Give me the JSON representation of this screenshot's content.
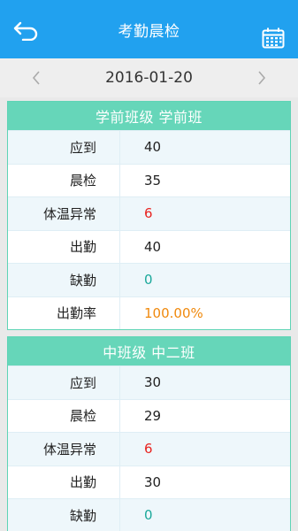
{
  "header": {
    "title": "考勤晨检",
    "back_icon": "back-icon",
    "calendar_icon": "calendar-icon",
    "accent_color": "#21a1ef"
  },
  "date_nav": {
    "date": "2016-01-20",
    "prev_icon": "chevron-left-icon",
    "next_icon": "chevron-right-icon"
  },
  "classes": [
    {
      "title": "学前班级 学前班",
      "rows": [
        {
          "label": "应到",
          "value": "40"
        },
        {
          "label": "晨检",
          "value": "35"
        },
        {
          "label": "体温异常",
          "value": "6"
        },
        {
          "label": "出勤",
          "value": "40"
        },
        {
          "label": "缺勤",
          "value": "0"
        },
        {
          "label": "出勤率",
          "value": "100.00%"
        }
      ]
    },
    {
      "title": "中班级 中二班",
      "rows": [
        {
          "label": "应到",
          "value": "30"
        },
        {
          "label": "晨检",
          "value": "29"
        },
        {
          "label": "体温异常",
          "value": "6"
        },
        {
          "label": "出勤",
          "value": "30"
        },
        {
          "label": "缺勤",
          "value": "0"
        }
      ]
    }
  ],
  "colors": {
    "card_header": "#66d6b9",
    "abnormal": "#e8231f",
    "absent": "#1aa89a",
    "rate": "#f0890d"
  }
}
